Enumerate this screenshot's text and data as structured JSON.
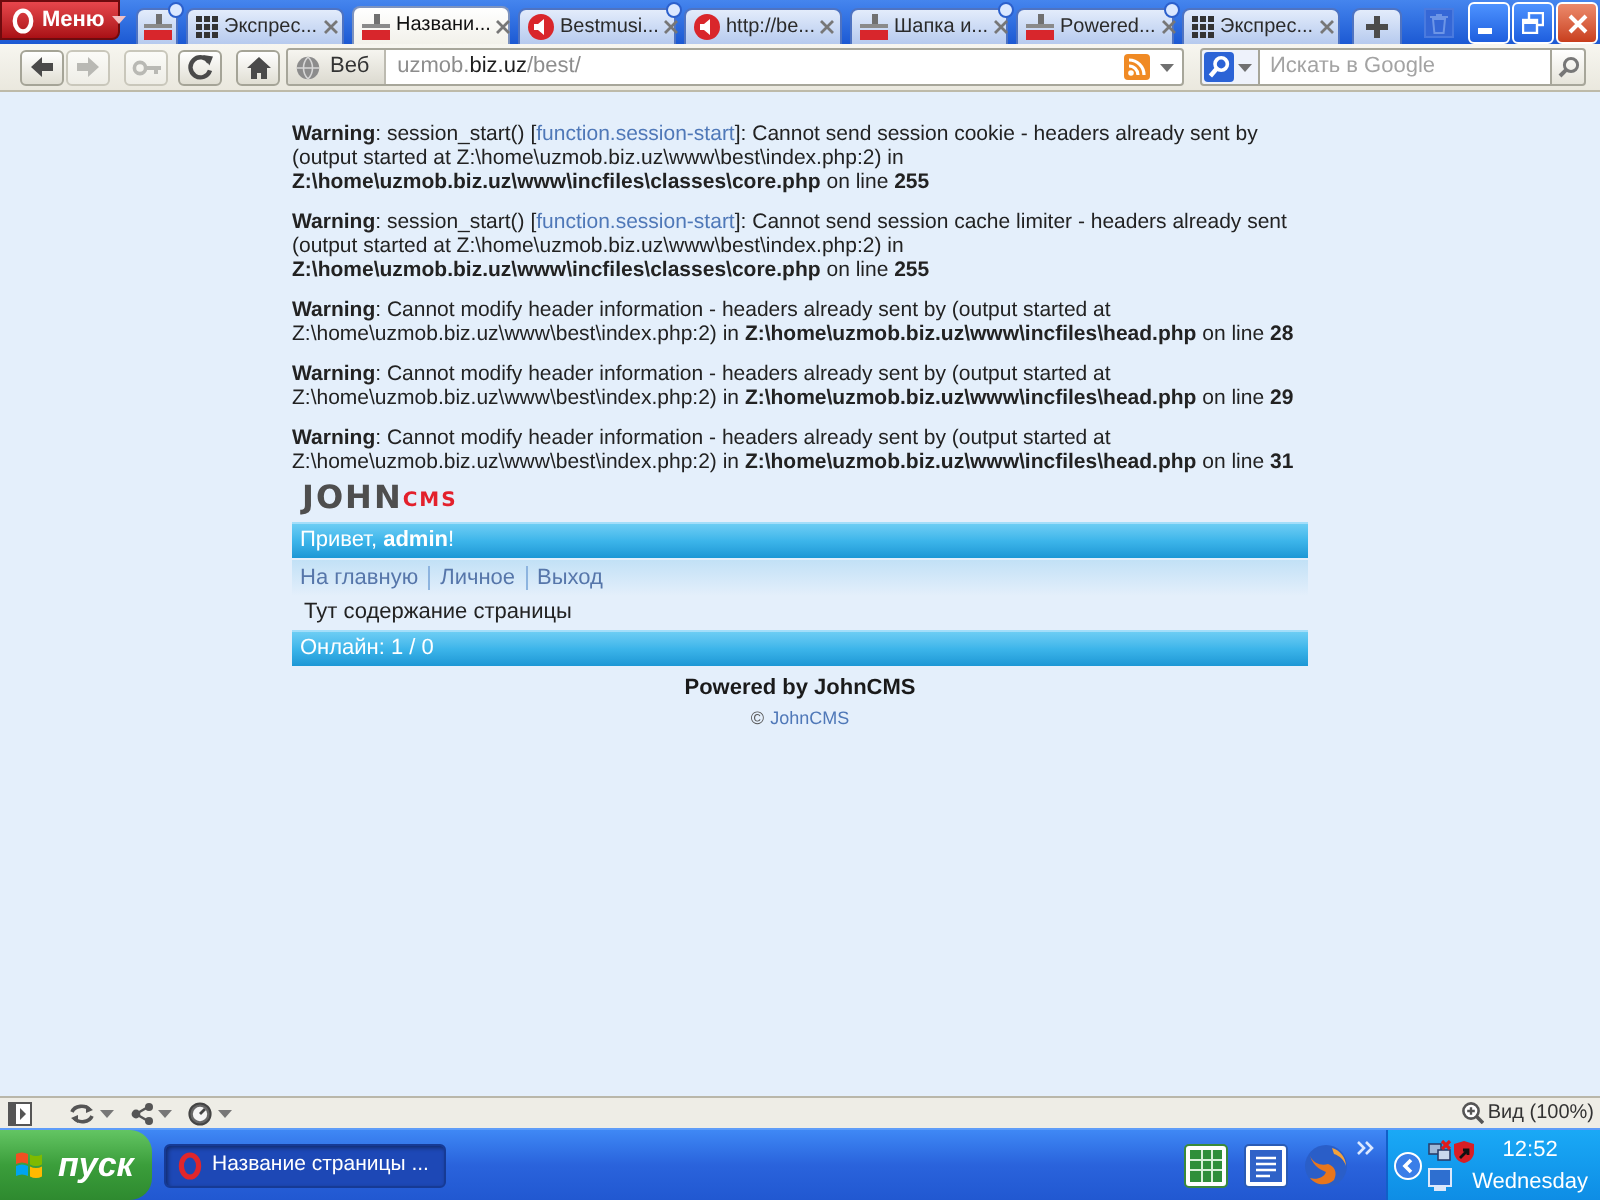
{
  "browser": {
    "menu_button": "Меню",
    "tabs": [
      {
        "kind": "pinned",
        "selected": false,
        "updated": true
      },
      {
        "kind": "speeddial",
        "label": "Экспрес...",
        "selected": false,
        "updated": false
      },
      {
        "kind": "cms",
        "label": "Названи...",
        "selected": true,
        "updated": false
      },
      {
        "kind": "media",
        "label": "Bestmusi...",
        "selected": false,
        "updated": true
      },
      {
        "kind": "media",
        "label": "http://be...",
        "selected": false,
        "updated": false
      },
      {
        "kind": "cms",
        "label": "Шапка и...",
        "selected": false,
        "updated": true
      },
      {
        "kind": "cms",
        "label": "Powered...",
        "selected": false,
        "updated": true
      },
      {
        "kind": "speeddial",
        "label": "Экспрес...",
        "selected": false,
        "updated": false
      }
    ],
    "nav_buttons": [
      {
        "kind": "back",
        "disabled": false
      },
      {
        "kind": "forward",
        "disabled": true
      },
      {
        "kind": "key",
        "disabled": true
      },
      {
        "kind": "reload",
        "disabled": false
      },
      {
        "kind": "home",
        "disabled": false
      }
    ],
    "address": {
      "site_button": "Веб",
      "url_start": "uzmob.",
      "domain": "biz.uz",
      "url_end": "/best/"
    },
    "search": {
      "placeholder": "Искать в Google"
    }
  },
  "page": {
    "warnings": [
      {
        "text": "**Warning**: session_start() [",
        "link": "function.session-start",
        "after": "]: Cannot send session cookie - headers already sent by (output started at Z:\\home\\uzmob.biz.uz\\www\\best\\index.php:2) in **Z:\\home\\uzmob.biz.uz\\www\\incfiles\\classes\\core.php** on line **255**"
      },
      {
        "text": "**Warning**: session_start() [",
        "link": "function.session-start",
        "after": "]: Cannot send session cache limiter - headers already sent (output started at Z:\\home\\uzmob.biz.uz\\www\\best\\index.php:2) in **Z:\\home\\uzmob.biz.uz\\www\\incfiles\\classes\\core.php** on line **255**"
      },
      {
        "text": "**Warning**: Cannot modify header information - headers already sent by (output started at Z:\\home\\uzmob.biz.uz\\www\\best\\index.php:2) in **Z:\\home\\uzmob.biz.uz\\www\\incfiles\\head.php** on line **28**"
      },
      {
        "text": "**Warning**: Cannot modify header information - headers already sent by (output started at Z:\\home\\uzmob.biz.uz\\www\\best\\index.php:2) in **Z:\\home\\uzmob.biz.uz\\www\\incfiles\\head.php** on line **29**"
      },
      {
        "text": "**Warning**: Cannot modify header information - headers already sent by (output started at Z:\\home\\uzmob.biz.uz\\www\\best\\index.php:2) in **Z:\\home\\uzmob.biz.uz\\www\\incfiles\\head.php** on line **31**"
      }
    ],
    "logo": {
      "main": "JOHN",
      "accent": "CMS"
    },
    "greeting": "Привет, **admin**!",
    "menu": [
      "На главную",
      "Личное",
      "Выход"
    ],
    "content": "Тут содержание страницы",
    "online": "Онлайн: 1 / 0",
    "powered": "Powered by JohnCMS",
    "copyright": {
      "symbol": "©",
      "link": "JohnCMS"
    }
  },
  "status_bar": {
    "zoom": "Вид (100%)"
  },
  "taskbar": {
    "start_button": "пуск",
    "tasks": [
      {
        "label": "Название страницы ...",
        "selected": true
      }
    ],
    "clock": {
      "time": "12:52",
      "day": "Wednesday"
    }
  }
}
